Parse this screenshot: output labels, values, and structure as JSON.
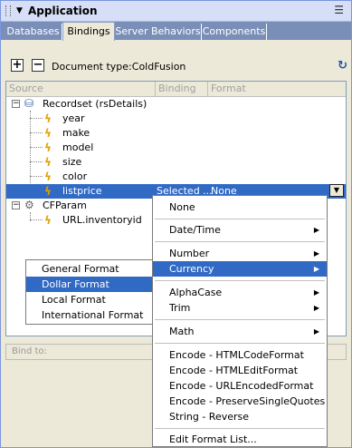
{
  "panel": {
    "title": "Application"
  },
  "tabs": [
    {
      "label": "Databases",
      "active": false
    },
    {
      "label": "Bindings",
      "active": true
    },
    {
      "label": "Server Behaviors",
      "active": false
    },
    {
      "label": "Components",
      "active": false
    }
  ],
  "toolbar": {
    "add_label": "+",
    "remove_label": "−",
    "doc_type": "Document type:ColdFusion"
  },
  "columns": {
    "source": "Source",
    "binding": "Binding",
    "format": "Format"
  },
  "tree": {
    "recordset": "Recordset (rsDetails)",
    "fields": [
      "year",
      "make",
      "model",
      "size",
      "color"
    ],
    "selected_field": "listprice",
    "selected_binding": "Selected ...",
    "selected_format": "None",
    "cfparam": "CFParam",
    "cfparam_child": "URL.inventoryid"
  },
  "bind_to": {
    "label": "Bind to:"
  },
  "format_menu": {
    "none": "None",
    "date_time": "Date/Time",
    "number": "Number",
    "currency": "Currency",
    "alphacase": "AlphaCase",
    "trim": "Trim",
    "math": "Math",
    "encode_items": [
      "Encode - HTMLCodeFormat",
      "Encode - HTMLEditFormat",
      "Encode - URLEncodedFormat",
      "Encode - PreserveSingleQuotes",
      "String - Reverse"
    ],
    "edit_list": "Edit Format List..."
  },
  "currency_submenu": {
    "items": [
      "General Format",
      "Dollar Format",
      "Local Format",
      "International Format"
    ],
    "highlighted": "Dollar Format"
  },
  "colors": {
    "selection": "#316ac5",
    "tab_bar": "#7a8fb8",
    "title_bar": "#d6dff7",
    "panel_bg": "#ece9d8"
  }
}
